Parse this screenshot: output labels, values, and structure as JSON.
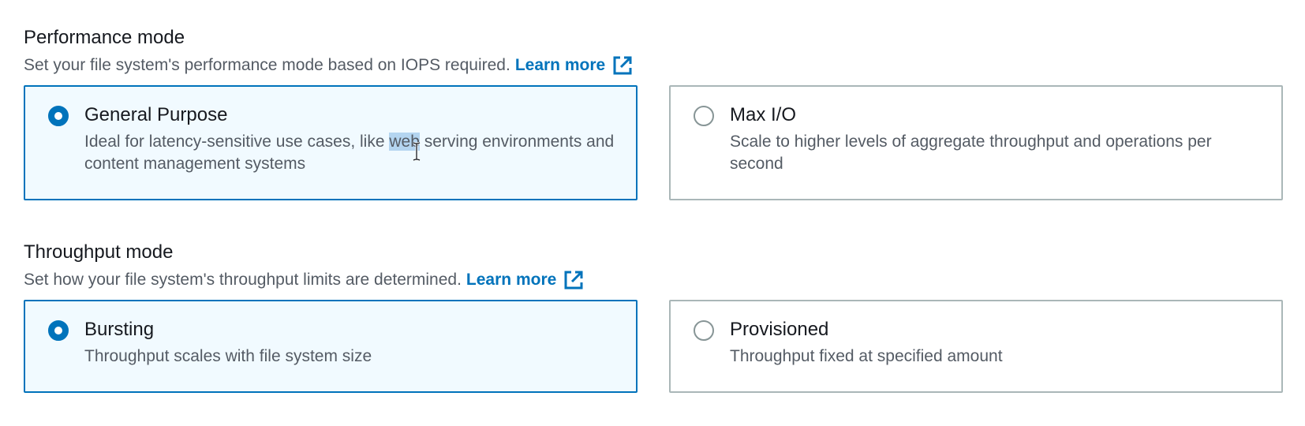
{
  "performance_mode": {
    "heading": "Performance mode",
    "description": "Set your file system's performance mode based on IOPS required.",
    "learn_more": "Learn more",
    "options": [
      {
        "title": "General Purpose",
        "description_before": "Ideal for latency-sensitive use cases, like ",
        "description_highlight": "web",
        "description_after": " serving environments and content management systems",
        "selected": true
      },
      {
        "title": "Max I/O",
        "description": "Scale to higher levels of aggregate throughput and operations per second",
        "selected": false
      }
    ]
  },
  "throughput_mode": {
    "heading": "Throughput mode",
    "description": "Set how your file system's throughput limits are determined.",
    "learn_more": "Learn more",
    "options": [
      {
        "title": "Bursting",
        "description": "Throughput scales with file system size",
        "selected": true
      },
      {
        "title": "Provisioned",
        "description": "Throughput fixed at specified amount",
        "selected": false
      }
    ]
  },
  "icons": {
    "external_link": "external-link-icon",
    "text_cursor": "text-cursor-icon"
  },
  "colors": {
    "accent": "#0073bb",
    "selected_bg": "#f1faff",
    "border": "#aab7b8",
    "text_primary": "#16191f",
    "text_secondary": "#545b64"
  }
}
